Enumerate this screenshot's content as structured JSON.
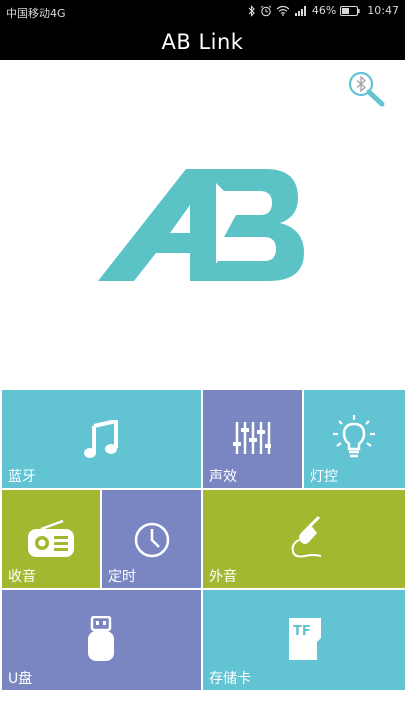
{
  "status_bar": {
    "carrier": "中国移动4G",
    "battery": "46%",
    "time": "10:47"
  },
  "header": {
    "title": "AB Link"
  },
  "logo": {
    "text": "AB",
    "color": "#5bc3c5"
  },
  "tiles": [
    {
      "label": "蓝牙",
      "icon": "music-note-icon",
      "color": "#62c4d3"
    },
    {
      "label": "声效",
      "icon": "equalizer-icon",
      "color": "#7a86c2"
    },
    {
      "label": "灯控",
      "icon": "light-bulb-icon",
      "color": "#62c4d3"
    },
    {
      "label": "收音",
      "icon": "radio-icon",
      "color": "#a3b830"
    },
    {
      "label": "定时",
      "icon": "clock-icon",
      "color": "#7a86c2"
    },
    {
      "label": "外音",
      "icon": "audio-jack-icon",
      "color": "#a3b830"
    },
    {
      "label": "U盘",
      "icon": "usb-drive-icon",
      "color": "#7a86c2"
    },
    {
      "label": "存储卡",
      "icon": "tf-card-icon",
      "color": "#62c4d3"
    }
  ],
  "tf_card": {
    "text": "TF"
  }
}
